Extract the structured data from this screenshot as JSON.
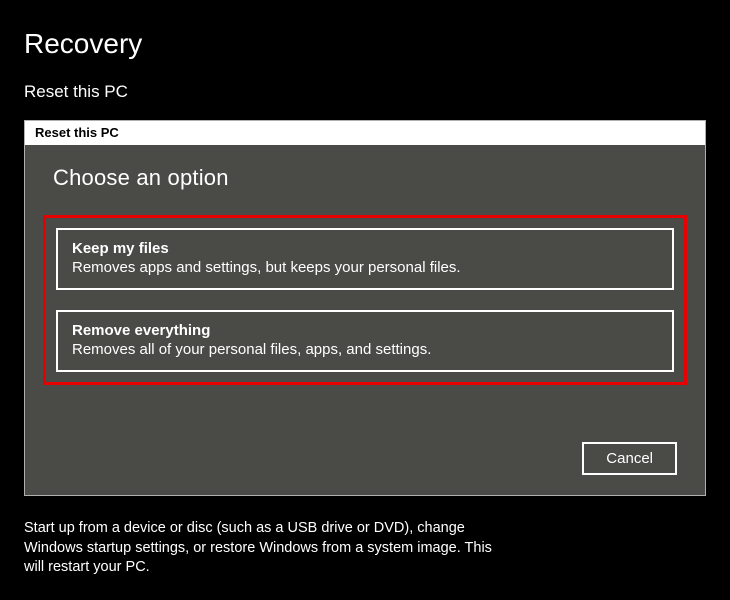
{
  "page": {
    "title": "Recovery",
    "subtitle": "Reset this PC"
  },
  "dialog": {
    "titlebar": "Reset this PC",
    "heading": "Choose an option",
    "options": [
      {
        "title": "Keep my files",
        "description": "Removes apps and settings, but keeps your personal files."
      },
      {
        "title": "Remove everything",
        "description": "Removes all of your personal files, apps, and settings."
      }
    ],
    "cancel_label": "Cancel"
  },
  "footer": {
    "text": "Start up from a device or disc (such as a USB drive or DVD), change Windows startup settings, or restore Windows from a system image. This will restart your PC."
  },
  "colors": {
    "highlight_border": "#e60000",
    "dialog_body": "#4a4a47"
  }
}
